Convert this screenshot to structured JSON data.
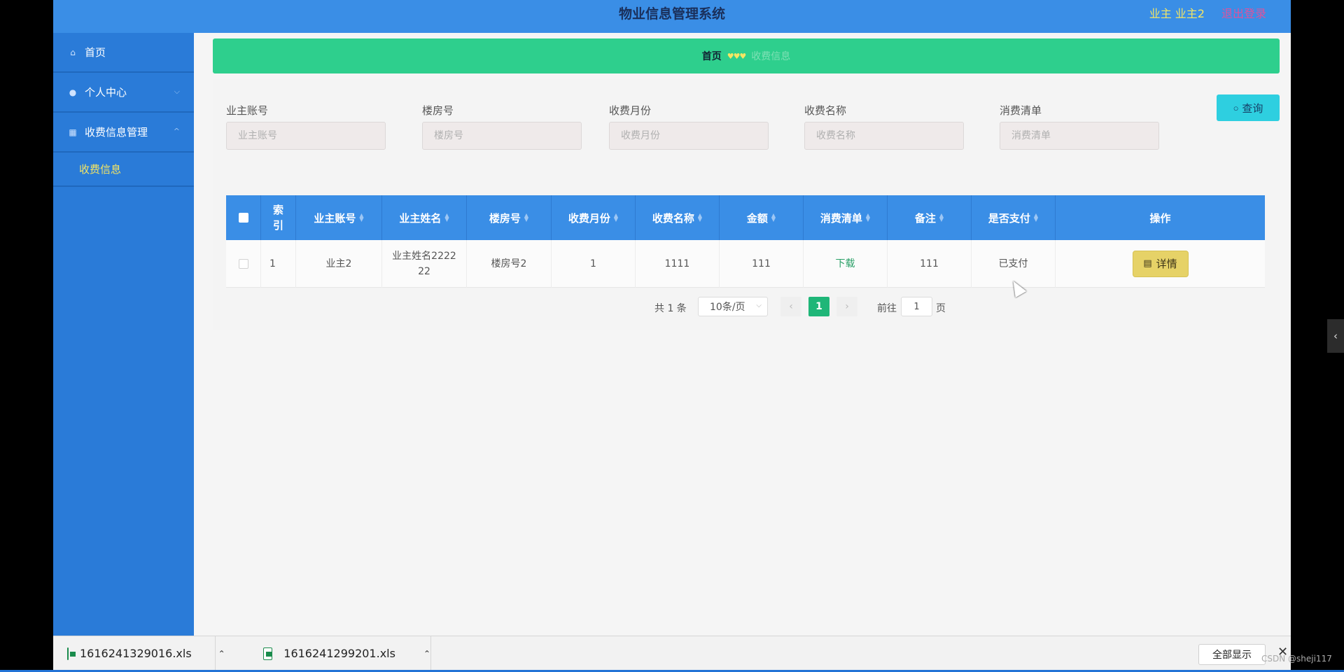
{
  "header": {
    "title": "物业信息管理系统",
    "user_info": "业主 业主2",
    "logout": "退出登录"
  },
  "sidebar": {
    "items": [
      {
        "label": "首页",
        "icon": "home-icon"
      },
      {
        "label": "个人中心",
        "icon": "user-icon"
      },
      {
        "label": "收费信息管理",
        "icon": "grid-icon"
      }
    ],
    "sub_items": [
      {
        "label": "收费信息"
      }
    ]
  },
  "breadcrumb": {
    "home": "首页",
    "separator": "♥♥♥",
    "current": "收费信息"
  },
  "search": {
    "fields": [
      {
        "label": "业主账号",
        "placeholder": "业主账号"
      },
      {
        "label": "楼房号",
        "placeholder": "楼房号"
      },
      {
        "label": "收费月份",
        "placeholder": "收费月份"
      },
      {
        "label": "收费名称",
        "placeholder": "收费名称"
      },
      {
        "label": "消费清单",
        "placeholder": "消费清单"
      }
    ],
    "query_button": "查询"
  },
  "table": {
    "columns": [
      "索引",
      "业主账号",
      "业主姓名",
      "楼房号",
      "收费月份",
      "收费名称",
      "金额",
      "消费清单",
      "备注",
      "是否支付",
      "操作"
    ],
    "rows": [
      {
        "index": "1",
        "account": "业主2",
        "name": "业主姓名222222",
        "building": "楼房号2",
        "month": "1",
        "fee_name": "1111",
        "amount": "111",
        "list": "下载",
        "note": "111",
        "paid": "已支付",
        "action": "详情"
      }
    ]
  },
  "pagination": {
    "total": "共 1 条",
    "page_size": "10条/页",
    "current_page": "1",
    "goto_label": "前往",
    "goto_value": "1",
    "page_unit": "页"
  },
  "downloads": {
    "files": [
      "1616241329016.xls",
      "1616241299201.xls"
    ],
    "show_all": "全部显示"
  },
  "watermark": "CSDN @sheji117",
  "colors": {
    "topbar": "#3a8ee6",
    "sidebar": "#2a7bd8",
    "breadcrumb": "#2ecf8d",
    "query_button": "#2ecfe0",
    "detail_button": "#e6d267",
    "current_page": "#1fb678"
  }
}
